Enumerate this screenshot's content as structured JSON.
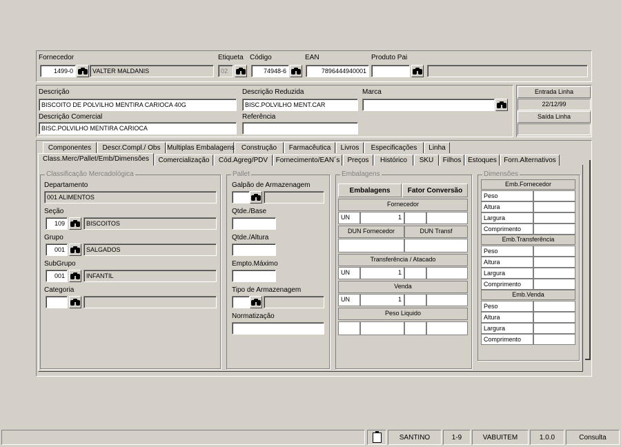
{
  "top": {
    "fornecedor_label": "Fornecedor",
    "fornecedor_code": "1499-0",
    "fornecedor_name": "VALTER MALDANIS",
    "etiqueta_label": "Etiqueta",
    "etiqueta_value": "02",
    "codigo_label": "Código",
    "codigo_value": "74948-6",
    "ean_label": "EAN",
    "ean_value": "7896444940001",
    "produto_pai_label": "Produto Pai",
    "produto_pai_value": "",
    "produto_pai_name": ""
  },
  "desc": {
    "descricao_label": "Descrição",
    "descricao_value": "BISCOITO DE POLVILHO MENTIRA CARIOCA 40G",
    "reduzida_label": "Descrição Reduzida",
    "reduzida_value": "BISC.POLVILHO MENT.CAR",
    "marca_label": "Marca",
    "marca_value": "",
    "comercial_label": "Descrição Comercial",
    "comercial_value": "BISC.POLVILHO MENTIRA CARIOCA",
    "referencia_label": "Referência",
    "referencia_value": "",
    "entrada_label": "Entrada Linha",
    "entrada_value": "22/12/99",
    "saida_label": "Saída Linha",
    "saida_value": ""
  },
  "tabs_row1": [
    "Componentes",
    "Descr.Compl./ Obs",
    "Multiplas Embalagens",
    "Construção",
    "Farmacêutica",
    "Livros",
    "Especificações",
    "Linha"
  ],
  "tabs_row2": [
    "Class.Merc/Pallet/Emb/Dimensões",
    "Comercialização",
    "Cód.Agreg/PDV",
    "Fornecimento/EAN´s",
    "Preços",
    "Histórico",
    "SKU",
    "Filhos",
    "Estoques",
    "Forn.Alternativos"
  ],
  "classificacao": {
    "title": "Classificação Mercadológica",
    "departamento_label": "Departamento",
    "departamento_value": "001 ALIMENTOS",
    "secao_label": "Seção",
    "secao_code": "109",
    "secao_name": "BISCOITOS",
    "grupo_label": "Grupo",
    "grupo_code": "001",
    "grupo_name": "SALGADOS",
    "subgrupo_label": "SubGrupo",
    "subgrupo_code": "001",
    "subgrupo_name": "INFANTIL",
    "categoria_label": "Categoria",
    "categoria_code": "",
    "categoria_name": ""
  },
  "pallet": {
    "title": "Pallet",
    "galpao_label": "Galpão de Armazenagem",
    "galpao_code": "",
    "galpao_name": "",
    "base_label": "Qtde./Base",
    "base_value": "",
    "altura_label": "Qtde./Altura",
    "altura_value": "",
    "empto_label": "Empto.Máximo",
    "empto_value": "",
    "tipo_label": "Tipo de Armazenagem",
    "tipo_code": "",
    "tipo_name": "",
    "normatizacao_label": "Normatização",
    "normatizacao_value": ""
  },
  "embalagens": {
    "title": "Embalagens",
    "col1": "Embalagens",
    "col2": "Fator Conversão",
    "fornecedor": "Fornecedor",
    "forn_un": "UN",
    "forn_qtd": "1",
    "dun_fornecedor": "DUN Fornecedor",
    "dun_transf": "DUN Transf",
    "transferencia": "Transferência / Atacado",
    "transf_un": "UN",
    "transf_qtd": "1",
    "venda": "Venda",
    "venda_un": "UN",
    "venda_qtd": "1",
    "peso_liquido": "Peso Liquido"
  },
  "dimensoes": {
    "title": "Dimensões",
    "groups": [
      {
        "name": "Emb.Fornecedor",
        "rows": [
          "Peso",
          "Altura",
          "Largura",
          "Comprimento"
        ]
      },
      {
        "name": "Emb.Transferência",
        "rows": [
          "Peso",
          "Altura",
          "Largura",
          "Comprimento"
        ]
      },
      {
        "name": "Emb.Venda",
        "rows": [
          "Peso",
          "Altura",
          "Largura",
          "Comprimento"
        ]
      }
    ]
  },
  "status": {
    "user": "SANTINO",
    "version_id": "1-9",
    "module": "VABUITEM",
    "app_version": "1.0.0",
    "mode": "Consulta"
  }
}
